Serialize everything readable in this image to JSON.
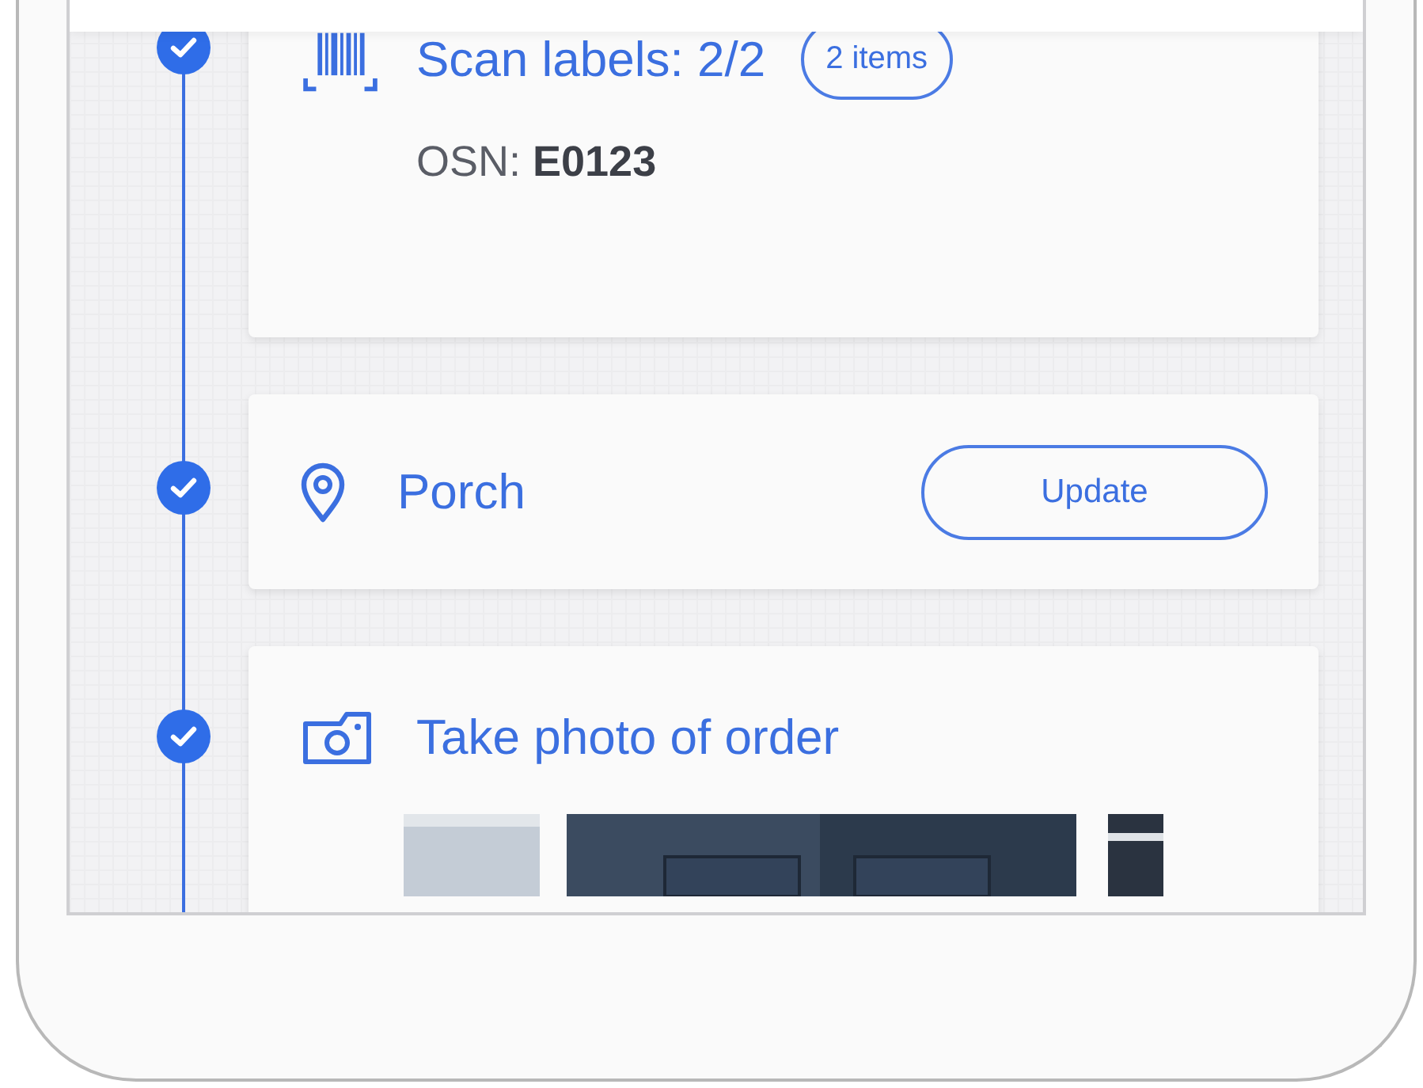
{
  "steps": [
    {
      "kind": "scan",
      "checked": true,
      "title": "Scan labels: 2/2",
      "badge": "2 items",
      "detail": "OSN: **E0123**"
    },
    {
      "kind": "location",
      "checked": true,
      "title": "Porch",
      "button": "Update"
    },
    {
      "checked": true,
      "title": "Take photo of order"
    }
  ]
}
